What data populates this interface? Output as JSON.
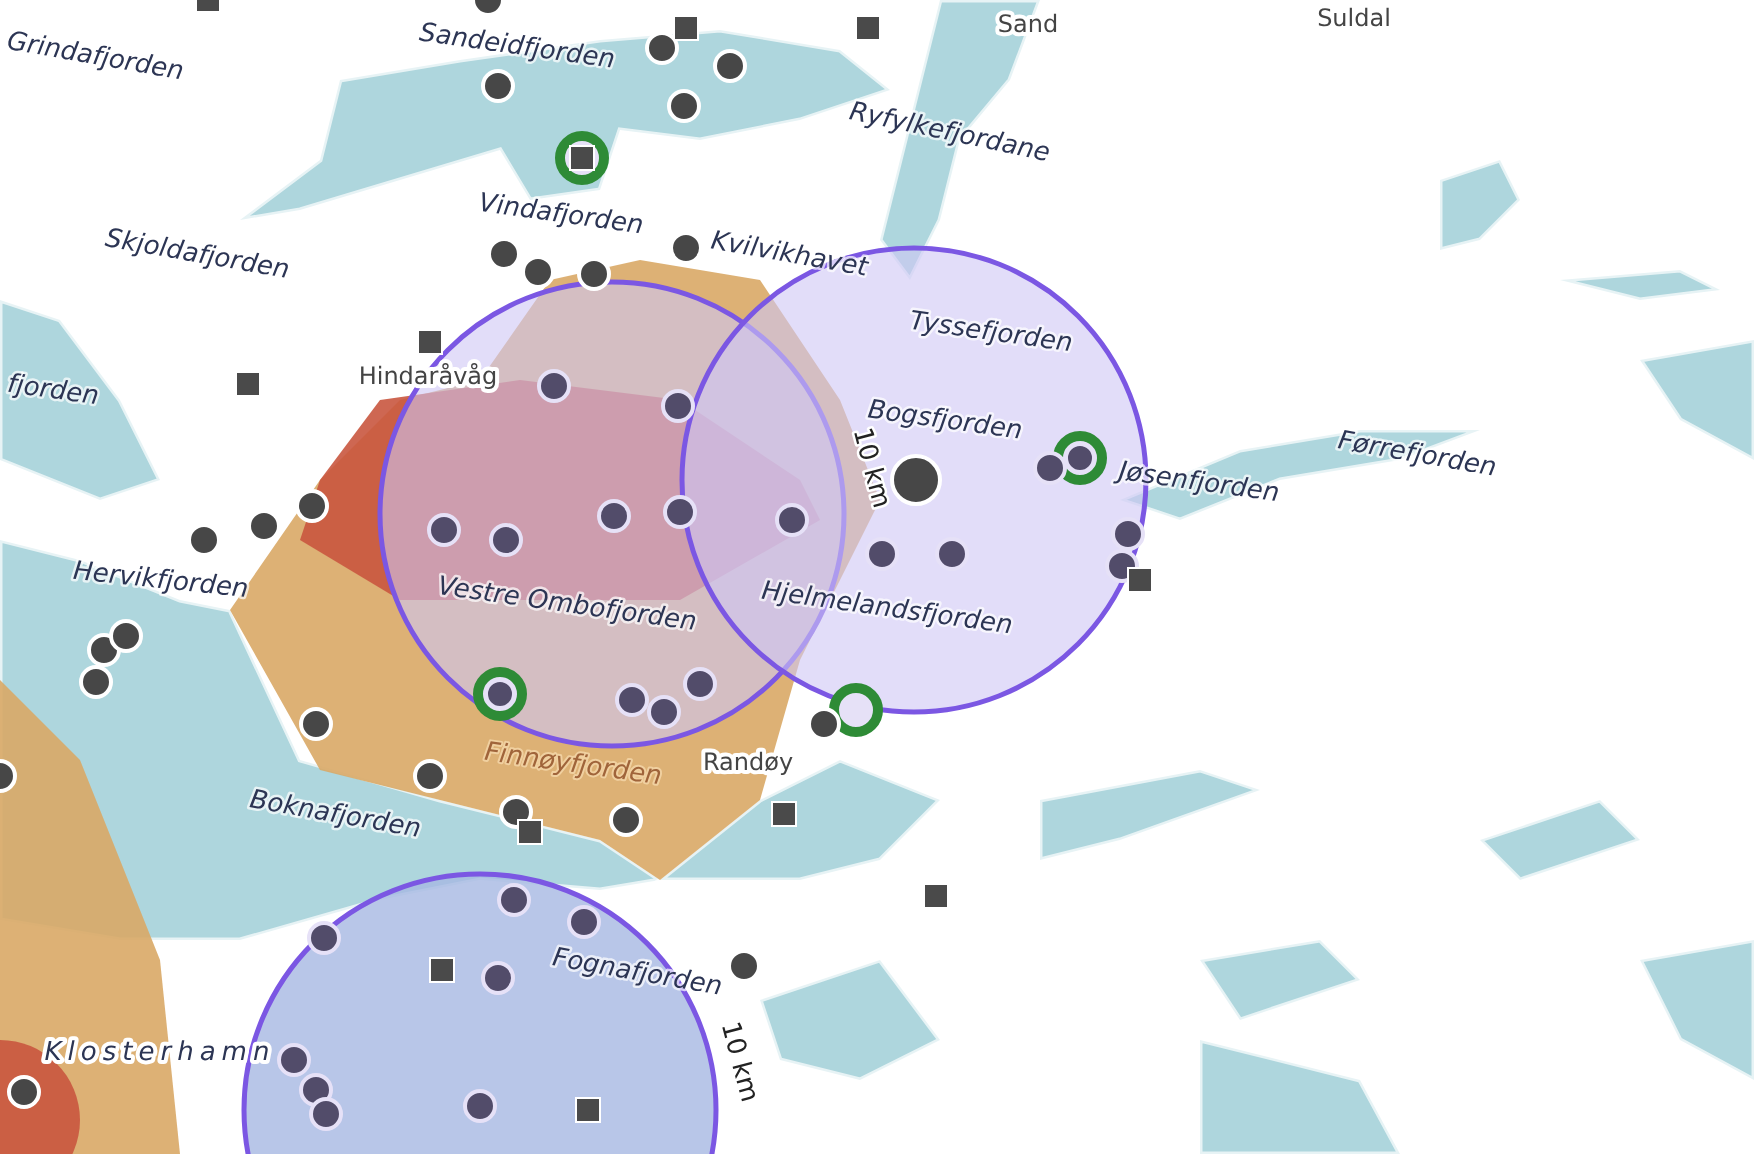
{
  "map": {
    "labels": [
      {
        "text": "Sandeidfjorden",
        "kind": "water"
      },
      {
        "text": "Grindafjorden",
        "kind": "water"
      },
      {
        "text": "Ryfylkefjordane",
        "kind": "water"
      },
      {
        "text": "Sand",
        "kind": "place"
      },
      {
        "text": "Suldal",
        "kind": "place"
      },
      {
        "text": "Vindafjorden",
        "kind": "water"
      },
      {
        "text": "Kvilvikhavet",
        "kind": "water"
      },
      {
        "text": "Skjoldafjorden",
        "kind": "water"
      },
      {
        "text": "Hindaråvåg",
        "kind": "place"
      },
      {
        "text": "fjorden",
        "kind": "water"
      },
      {
        "text": "Tyssefjorden",
        "kind": "water"
      },
      {
        "text": "Bogsfjorden",
        "kind": "water"
      },
      {
        "text": "10 km",
        "kind": "distance"
      },
      {
        "text": "Jøsenfjorden",
        "kind": "water"
      },
      {
        "text": "Førrefjorden",
        "kind": "water"
      },
      {
        "text": "Hervikfjorden",
        "kind": "water"
      },
      {
        "text": "Vestre Ombofjorden",
        "kind": "water"
      },
      {
        "text": "Hjelmelandsfjorden",
        "kind": "water"
      },
      {
        "text": "Randøy",
        "kind": "place"
      },
      {
        "text": "Finnøyfjorden",
        "kind": "zone"
      },
      {
        "text": "Boknafjorden",
        "kind": "water"
      },
      {
        "text": "Fognafjorden",
        "kind": "water"
      },
      {
        "text": "10 km",
        "kind": "distance"
      },
      {
        "text": "Klosterhamn",
        "kind": "spaced"
      }
    ]
  }
}
